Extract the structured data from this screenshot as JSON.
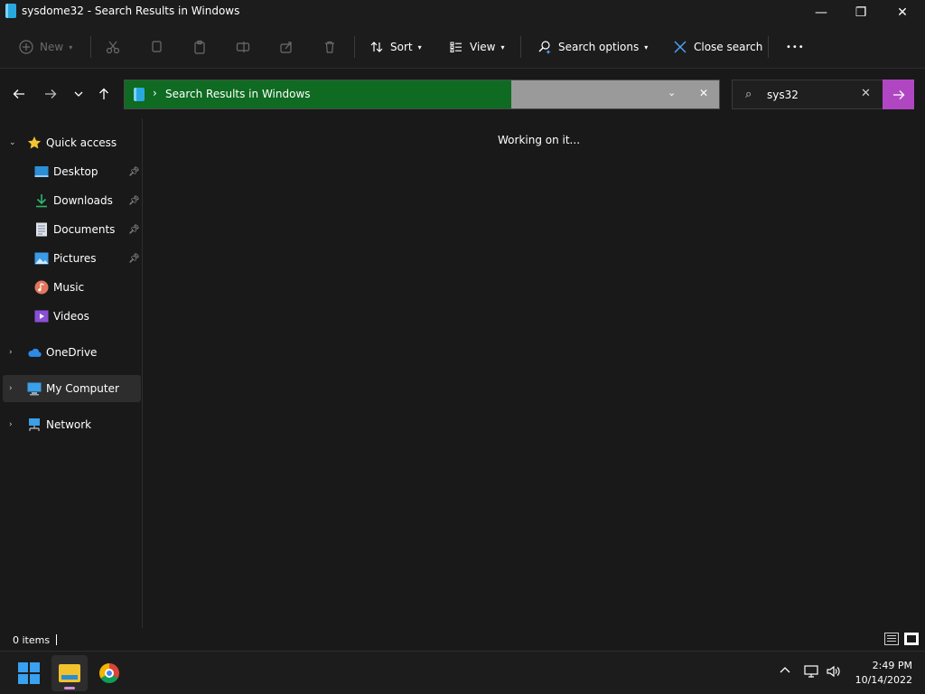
{
  "window": {
    "title": "sysdome32 - Search Results in Windows",
    "minimize_glyph": "—",
    "maximize_glyph": "❐",
    "close_glyph": "✕"
  },
  "toolbar": {
    "new_label": "New",
    "sort_label": "Sort",
    "view_label": "View",
    "search_options_label": "Search options",
    "close_search_label": "Close search",
    "more_glyph": "•••"
  },
  "address": {
    "breadcrumb": "Search Results in Windows",
    "progress": 0.65
  },
  "search": {
    "value": "sys32"
  },
  "sidebar": {
    "quick_access": "Quick access",
    "items": [
      {
        "label": "Desktop",
        "icon": "desktop-icon"
      },
      {
        "label": "Downloads",
        "icon": "download-icon"
      },
      {
        "label": "Documents",
        "icon": "document-icon"
      },
      {
        "label": "Pictures",
        "icon": "pictures-icon"
      },
      {
        "label": "Music",
        "icon": "music-icon"
      },
      {
        "label": "Videos",
        "icon": "videos-icon"
      }
    ],
    "onedrive": "OneDrive",
    "my_computer": "My Computer",
    "network": "Network"
  },
  "content": {
    "status_message": "Working on it..."
  },
  "statusbar": {
    "item_count": "0 items"
  },
  "taskbar": {
    "time": "2:49 PM",
    "date": "10/14/2022"
  },
  "colors": {
    "progress": "#0e6b21",
    "accent_search_button": "#b146c2",
    "background": "#191919"
  }
}
